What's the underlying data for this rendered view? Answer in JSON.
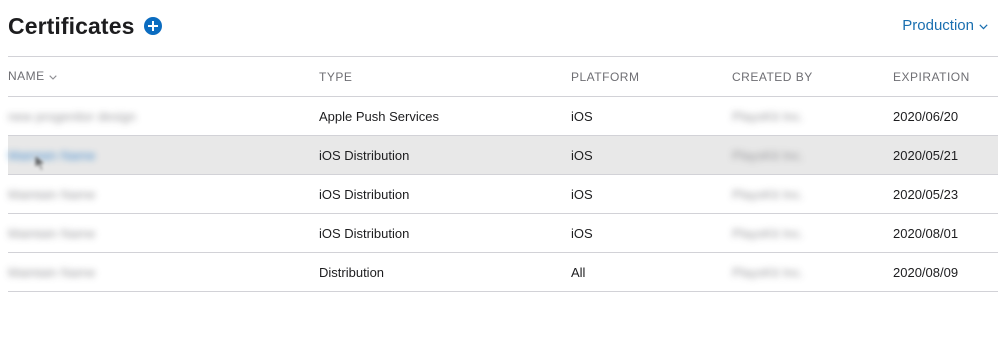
{
  "header": {
    "title": "Certificates",
    "environment": "Production"
  },
  "table": {
    "columns": {
      "name": "NAME",
      "type": "TYPE",
      "platform": "PLATFORM",
      "created_by": "CREATED BY",
      "expiration": "EXPIRATION"
    },
    "rows": [
      {
        "name": "new progenitor design",
        "type": "Apple Push Services",
        "platform": "iOS",
        "created_by": "PlaysKit Inc.",
        "expiration": "2020/06/20"
      },
      {
        "name": "Maintain Name",
        "type": "iOS Distribution",
        "platform": "iOS",
        "created_by": "PlaysKit Inc.",
        "expiration": "2020/05/21"
      },
      {
        "name": "Maintain Name",
        "type": "iOS Distribution",
        "platform": "iOS",
        "created_by": "PlaysKit Inc.",
        "expiration": "2020/05/23"
      },
      {
        "name": "Maintain Name",
        "type": "iOS Distribution",
        "platform": "iOS",
        "created_by": "PlaysKit Inc.",
        "expiration": "2020/08/01"
      },
      {
        "name": "Maintain Name",
        "type": "Distribution",
        "platform": "All",
        "created_by": "PlaysKit Inc.",
        "expiration": "2020/08/09"
      }
    ]
  },
  "colors": {
    "accent": "#0b6cc0",
    "link": "#1a6fb0",
    "row_highlight": "#e8e8e8",
    "divider": "#d2d2d7"
  },
  "icons": {
    "add": "plus-circle-icon",
    "environment_dropdown": "chevron-down-icon",
    "sort": "chevron-down-icon",
    "pointer": "cursor-icon"
  }
}
